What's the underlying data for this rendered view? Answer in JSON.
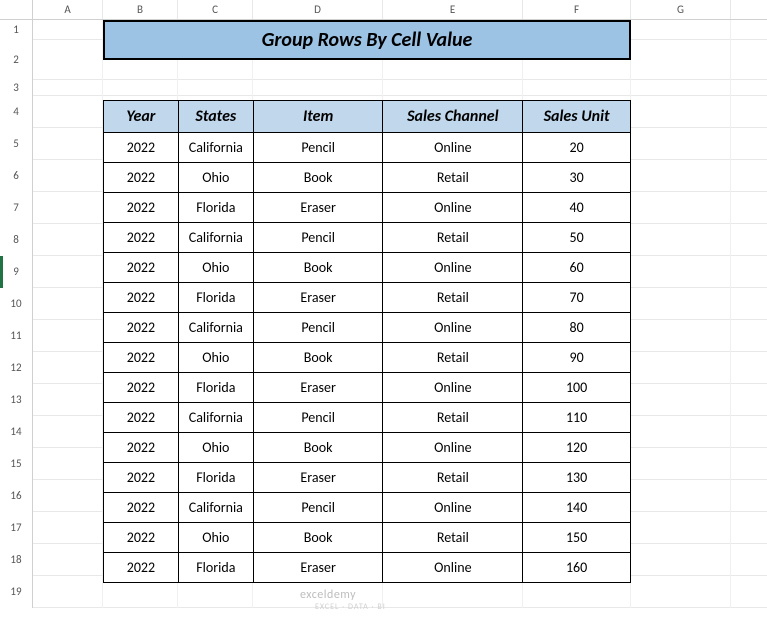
{
  "columns": [
    "A",
    "B",
    "C",
    "D",
    "E",
    "F",
    "G"
  ],
  "row_numbers": [
    "1",
    "2",
    "3",
    "4",
    "5",
    "6",
    "7",
    "8",
    "9",
    "10",
    "11",
    "12",
    "13",
    "14",
    "15",
    "16",
    "17",
    "18",
    "19"
  ],
  "selected_row": 9,
  "title": "Group Rows By Cell Value",
  "headers": {
    "year": "Year",
    "states": "States",
    "item": "Item",
    "channel": "Sales Channel",
    "unit": "Sales Unit"
  },
  "rows": [
    {
      "year": "2022",
      "state": "California",
      "item": "Pencil",
      "channel": "Online",
      "unit": "20"
    },
    {
      "year": "2022",
      "state": "Ohio",
      "item": "Book",
      "channel": "Retail",
      "unit": "30"
    },
    {
      "year": "2022",
      "state": "Florida",
      "item": "Eraser",
      "channel": "Online",
      "unit": "40"
    },
    {
      "year": "2022",
      "state": "California",
      "item": "Pencil",
      "channel": "Retail",
      "unit": "50"
    },
    {
      "year": "2022",
      "state": "Ohio",
      "item": "Book",
      "channel": "Online",
      "unit": "60"
    },
    {
      "year": "2022",
      "state": "Florida",
      "item": "Eraser",
      "channel": "Retail",
      "unit": "70"
    },
    {
      "year": "2022",
      "state": "California",
      "item": "Pencil",
      "channel": "Online",
      "unit": "80"
    },
    {
      "year": "2022",
      "state": "Ohio",
      "item": "Book",
      "channel": "Retail",
      "unit": "90"
    },
    {
      "year": "2022",
      "state": "Florida",
      "item": "Eraser",
      "channel": "Online",
      "unit": "100"
    },
    {
      "year": "2022",
      "state": "California",
      "item": "Pencil",
      "channel": "Retail",
      "unit": "110"
    },
    {
      "year": "2022",
      "state": "Ohio",
      "item": "Book",
      "channel": "Online",
      "unit": "120"
    },
    {
      "year": "2022",
      "state": "Florida",
      "item": "Eraser",
      "channel": "Retail",
      "unit": "130"
    },
    {
      "year": "2022",
      "state": "California",
      "item": "Pencil",
      "channel": "Online",
      "unit": "140"
    },
    {
      "year": "2022",
      "state": "Ohio",
      "item": "Book",
      "channel": "Retail",
      "unit": "150"
    },
    {
      "year": "2022",
      "state": "Florida",
      "item": "Eraser",
      "channel": "Online",
      "unit": "160"
    }
  ],
  "watermark": {
    "main": "exceldemy",
    "sub": "EXCEL · DATA · BI"
  }
}
